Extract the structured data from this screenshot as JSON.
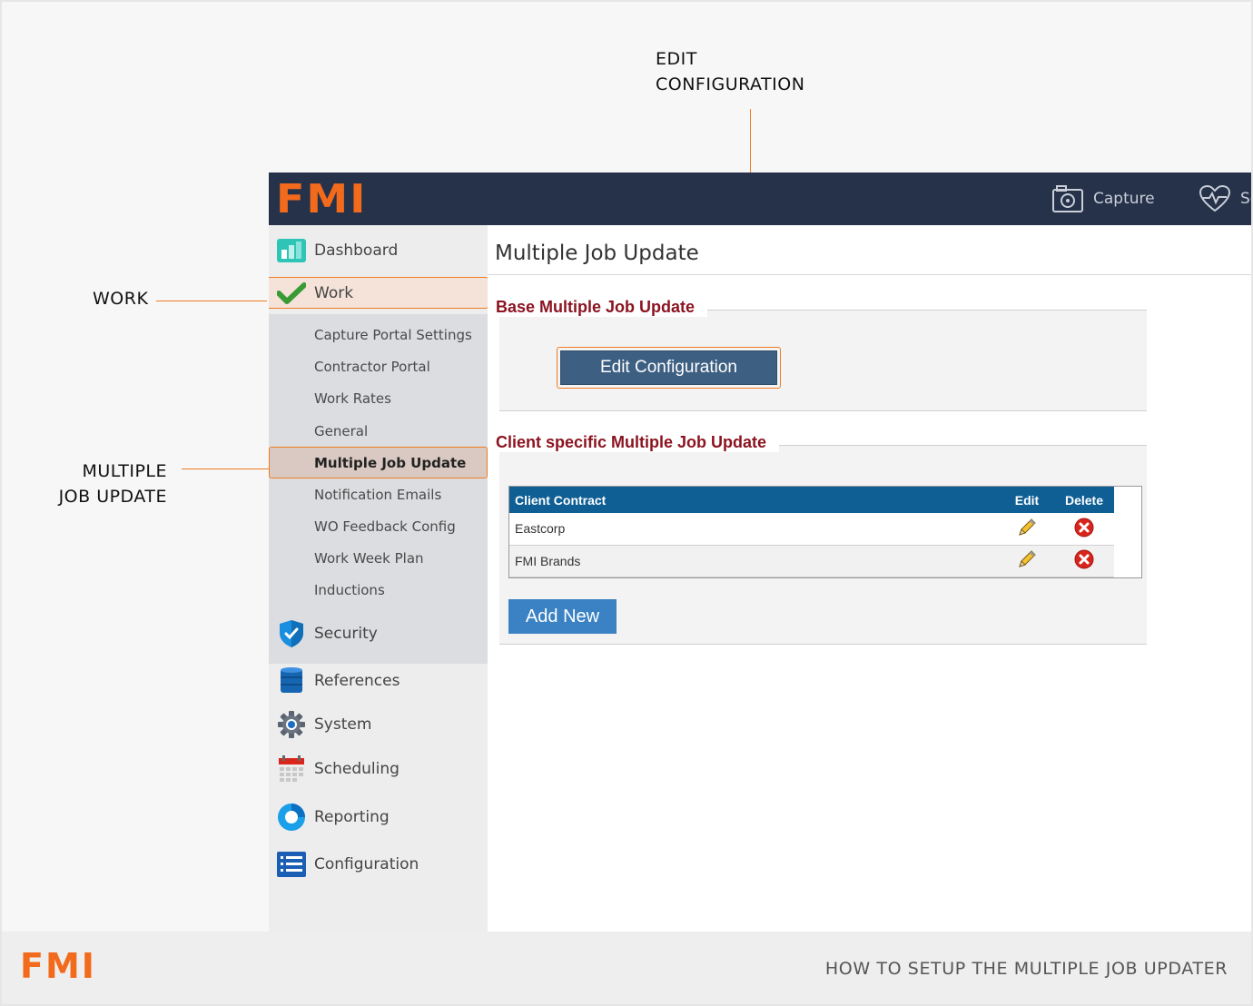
{
  "annotations": {
    "edit_configuration": [
      "EDIT",
      "CONFIGURATION"
    ],
    "work": "WORK",
    "multiple_job_update": [
      "MULTIPLE",
      "JOB UPDATE"
    ]
  },
  "header": {
    "logo": "FMI",
    "capture_label": "Capture",
    "second_label": "Se"
  },
  "sidebar": {
    "items": [
      {
        "label": "Dashboard",
        "icon": "dashboard-icon"
      },
      {
        "label": "Work",
        "icon": "checkmark-icon"
      },
      {
        "label": "Security",
        "icon": "shield-icon"
      },
      {
        "label": "References",
        "icon": "database-icon"
      },
      {
        "label": "System",
        "icon": "gear-icon"
      },
      {
        "label": "Scheduling",
        "icon": "calendar-icon"
      },
      {
        "label": "Reporting",
        "icon": "donut-chart-icon"
      },
      {
        "label": "Configuration",
        "icon": "list-icon"
      }
    ],
    "work_subitems": [
      "Capture Portal Settings",
      "Contractor Portal",
      "Work Rates",
      "General",
      "Multiple Job Update",
      "Notification Emails",
      "WO Feedback Config",
      "Work Week Plan",
      "Inductions"
    ]
  },
  "main": {
    "page_title": "Multiple Job Update",
    "base_section_title": "Base Multiple Job Update",
    "edit_configuration_label": "Edit Configuration",
    "client_section_title": "Client specific Multiple Job Update",
    "table": {
      "headers": [
        "Client Contract",
        "Edit",
        "Delete"
      ],
      "rows": [
        {
          "client": "Eastcorp"
        },
        {
          "client": "FMI Brands"
        }
      ]
    },
    "add_new_label": "Add New"
  },
  "footer": {
    "logo": "FMI",
    "caption": "HOW TO SETUP THE MULTIPLE JOB UPDATER"
  },
  "colors": {
    "brand_orange": "#f26a1b",
    "topbar": "#26324a",
    "section_title": "#8b1420",
    "table_header": "#0f5f95",
    "button_blue": "#3b82c4"
  }
}
